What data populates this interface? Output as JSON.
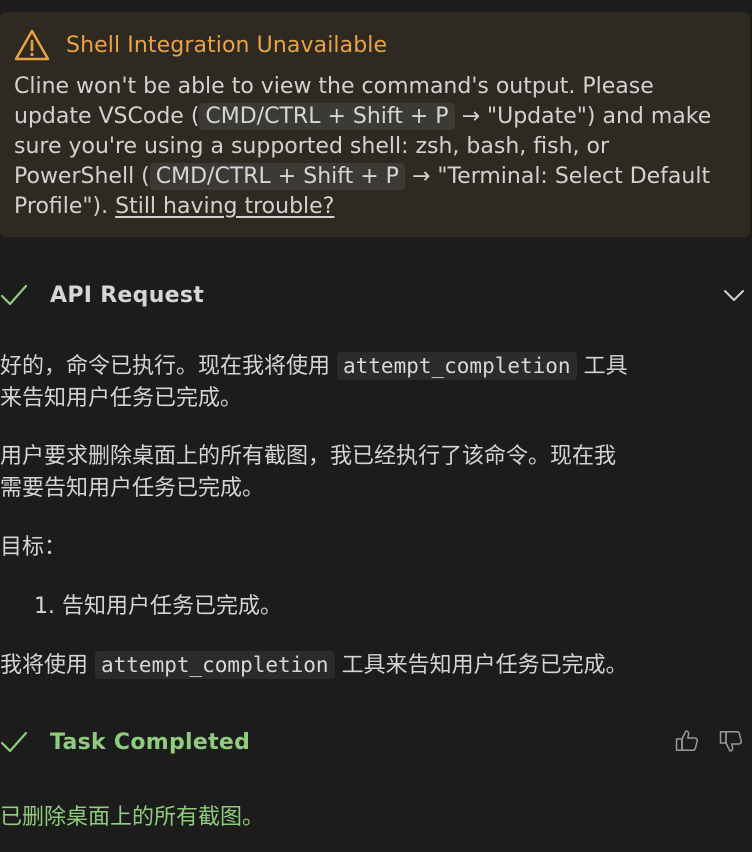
{
  "warning": {
    "title": "Shell Integration Unavailable",
    "line1": "Cline won't be able to view the command's output. Please",
    "line2_pre": "update VSCode (",
    "shortcut": "CMD/CTRL + Shift + P",
    "line2_post": " → \"Update\") and make",
    "line3": "sure you're using a supported shell: zsh, bash, fish, or",
    "line4_pre": "PowerShell (",
    "line4_post": " → \"Terminal: Select Default",
    "line5_pre": "Profile\"). ",
    "link": "Still having trouble?"
  },
  "api_request": {
    "title": "API Request"
  },
  "messages": {
    "p1_pre": "好的，命令已执行。现在我将使用 ",
    "p1_code": "attempt_completion",
    "p1_post_line1": " 工具",
    "p1_line2": "来告知用户任务已完成。",
    "p2_line1": "用户要求删除桌面上的所有截图，我已经执行了该命令。现在我",
    "p2_line2": "需要告知用户任务已完成。",
    "p3": "目标：",
    "list_item": "1. 告知用户任务已完成。",
    "p4_pre": "我将使用 ",
    "p4_code": "attempt_completion",
    "p4_post": " 工具来告知用户任务已完成。"
  },
  "task_completed": {
    "title": "Task Completed",
    "result": "已删除桌面上的所有截图。"
  },
  "colors": {
    "warning_accent": "#e9a344",
    "success_green": "#8fcc7d",
    "background": "#1c1c1c"
  }
}
